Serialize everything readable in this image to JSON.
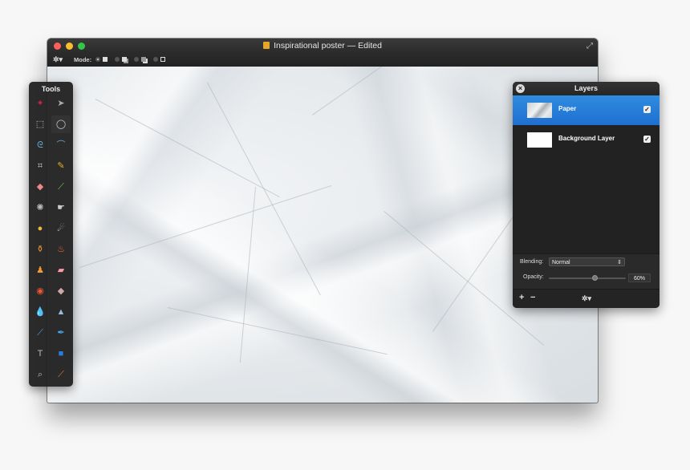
{
  "window": {
    "title": "Inspirational poster",
    "title_separator": "—",
    "title_status": "Edited"
  },
  "toolbar": {
    "gear_icon": "gear-icon",
    "mode_label": "Mode:",
    "mode_options": [
      "mode-1",
      "mode-2",
      "mode-3",
      "mode-4"
    ],
    "selected_mode": 0
  },
  "tools_panel": {
    "title": "Tools",
    "tools": [
      "magic-wand-icon",
      "move-arrow-icon",
      "rect-select-icon",
      "ellipse-select-icon",
      "lasso-icon",
      "polygon-lasso-icon",
      "crop-icon",
      "pencil-icon",
      "eraser-icon",
      "brush-icon",
      "sharpen-icon",
      "smudge-icon",
      "sponge-icon",
      "dodge-icon",
      "paint-bucket-icon",
      "burn-icon",
      "clone-stamp-icon",
      "heal-bandage-icon",
      "red-eye-icon",
      "blur-eraser-icon",
      "water-drop-icon",
      "cone-icon",
      "pen-icon",
      "vector-pen-icon",
      "text-icon",
      "shape-icon",
      "zoom-icon",
      "eyedropper-icon"
    ]
  },
  "layers_panel": {
    "title": "Layers",
    "layers": [
      {
        "name": "Paper",
        "visible": true,
        "selected": true
      },
      {
        "name": "Background Layer",
        "visible": true,
        "selected": false
      }
    ],
    "blending_label": "Blending:",
    "blending_value": "Normal",
    "opacity_label": "Opacity:",
    "opacity_value": "60%",
    "opacity_fraction": 0.6,
    "add_label": "+",
    "remove_label": "−"
  },
  "colors": {
    "selection_blue": "#1f6fd0",
    "panel_bg": "#222222"
  }
}
